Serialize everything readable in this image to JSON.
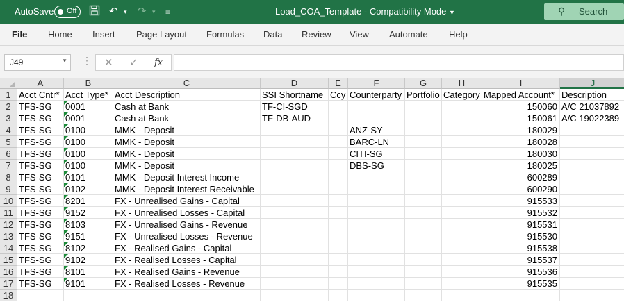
{
  "titlebar": {
    "autosave_label": "AutoSave",
    "autosave_state": "Off",
    "document_title": "Load_COA_Template  -  Compatibility Mode",
    "search_label": "Search"
  },
  "ribbon": {
    "tabs": [
      "File",
      "Home",
      "Insert",
      "Page Layout",
      "Formulas",
      "Data",
      "Review",
      "View",
      "Automate",
      "Help"
    ],
    "active_tab": "File"
  },
  "formula_bar": {
    "name_box": "J49",
    "fx_label": "fx",
    "formula": ""
  },
  "sheet": {
    "selected_column": "J",
    "columns": [
      "A",
      "B",
      "C",
      "D",
      "E",
      "F",
      "G",
      "H",
      "I",
      "J"
    ],
    "row_numbers": [
      "1",
      "2",
      "3",
      "4",
      "5",
      "6",
      "7",
      "8",
      "9",
      "10",
      "11",
      "12",
      "13",
      "14",
      "15",
      "16",
      "17",
      "18"
    ],
    "rows": [
      [
        "Acct Cntr*",
        "Acct Type*",
        "Acct Description",
        "SSI Shortname",
        "Ccy",
        "Counterparty",
        "Portfolio",
        "Category",
        "Mapped Account*",
        "Description"
      ],
      [
        "TFS-SG",
        "0001",
        "Cash at Bank",
        "TF-CI-SGD",
        "",
        "",
        "",
        "",
        "150060",
        "A/C 21037892"
      ],
      [
        "TFS-SG",
        "0001",
        "Cash at Bank",
        "TF-DB-AUD",
        "",
        "",
        "",
        "",
        "150061",
        "A/C 19022389"
      ],
      [
        "TFS-SG",
        "0100",
        "MMK - Deposit",
        "",
        "",
        "ANZ-SY",
        "",
        "",
        "180029",
        ""
      ],
      [
        "TFS-SG",
        "0100",
        "MMK - Deposit",
        "",
        "",
        "BARC-LN",
        "",
        "",
        "180028",
        ""
      ],
      [
        "TFS-SG",
        "0100",
        "MMK - Deposit",
        "",
        "",
        "CITI-SG",
        "",
        "",
        "180030",
        ""
      ],
      [
        "TFS-SG",
        "0100",
        "MMK - Deposit",
        "",
        "",
        "DBS-SG",
        "",
        "",
        "180025",
        ""
      ],
      [
        "TFS-SG",
        "0101",
        "MMK - Deposit Interest Income",
        "",
        "",
        "",
        "",
        "",
        "600289",
        ""
      ],
      [
        "TFS-SG",
        "0102",
        "MMK - Deposit Interest Receivable",
        "",
        "",
        "",
        "",
        "",
        "600290",
        ""
      ],
      [
        "TFS-SG",
        "8201",
        "FX - Unrealised Gains - Capital",
        "",
        "",
        "",
        "",
        "",
        "915533",
        ""
      ],
      [
        "TFS-SG",
        "9152",
        "FX - Unrealised Losses - Capital",
        "",
        "",
        "",
        "",
        "",
        "915532",
        ""
      ],
      [
        "TFS-SG",
        "8103",
        "FX - Unrealised Gains - Revenue",
        "",
        "",
        "",
        "",
        "",
        "915531",
        ""
      ],
      [
        "TFS-SG",
        "9151",
        "FX - Unrealised Losses - Revenue",
        "",
        "",
        "",
        "",
        "",
        "915530",
        ""
      ],
      [
        "TFS-SG",
        "8102",
        "FX - Realised Gains - Capital",
        "",
        "",
        "",
        "",
        "",
        "915538",
        ""
      ],
      [
        "TFS-SG",
        "9102",
        "FX - Realised Losses - Capital",
        "",
        "",
        "",
        "",
        "",
        "915537",
        ""
      ],
      [
        "TFS-SG",
        "8101",
        "FX - Realised Gains - Revenue",
        "",
        "",
        "",
        "",
        "",
        "915536",
        ""
      ],
      [
        "TFS-SG",
        "9101",
        "FX - Realised Losses - Revenue",
        "",
        "",
        "",
        "",
        "",
        "915535",
        ""
      ],
      [
        "",
        "",
        "",
        "",
        "",
        "",
        "",
        "",
        "",
        ""
      ]
    ]
  },
  "colors": {
    "brand_green": "#217346",
    "error_triangle": "#1d8a3a"
  }
}
